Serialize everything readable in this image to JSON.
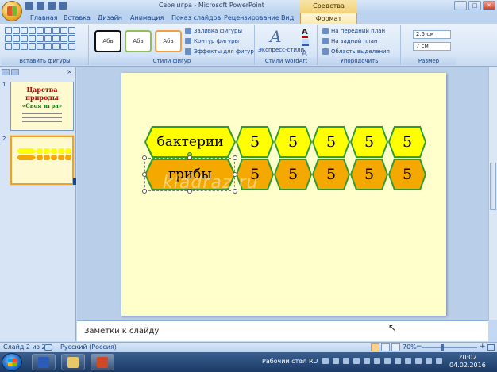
{
  "window": {
    "title": "Своя игра - Microsoft PowerPoint",
    "context_tab_title": "Средства рисования",
    "controls": [
      "–",
      "□",
      "✕"
    ]
  },
  "tabs": [
    {
      "label": "Главная"
    },
    {
      "label": "Вставка"
    },
    {
      "label": "Дизайн"
    },
    {
      "label": "Анимация"
    },
    {
      "label": "Показ слайдов"
    },
    {
      "label": "Рецензирование"
    },
    {
      "label": "Вид"
    },
    {
      "label": "Формат",
      "active": true
    }
  ],
  "ribbon": {
    "groups": [
      {
        "label": "Вставить фигуры"
      },
      {
        "label": "Стили фигур"
      },
      {
        "label": "Стили WordArt"
      },
      {
        "label": "Упорядочить"
      },
      {
        "label": "Размер"
      }
    ],
    "shape_styles": [
      "Абв",
      "Абв",
      "Абв"
    ],
    "shape_style_commands": [
      "Заливка фигуры",
      "Контур фигуры",
      "Эффекты для фигур"
    ],
    "wordart_label": "Экспресс-стили",
    "arrange_commands": [
      "На передний план",
      "На задний план",
      "Область выделения"
    ],
    "size": {
      "height": "2,5 см",
      "width": "7 см"
    }
  },
  "slides_pane": {
    "slides": [
      {
        "number": "1",
        "title": "Царства природы",
        "subtitle": "«Своя игра»"
      },
      {
        "number": "2",
        "selected": true
      }
    ]
  },
  "slide": {
    "rows": [
      {
        "category": "бактерии",
        "values": [
          "5",
          "5",
          "5",
          "5",
          "5"
        ],
        "color": "#ffff00"
      },
      {
        "category": "грибы",
        "values": [
          "5",
          "5",
          "5",
          "5",
          "5"
        ],
        "color": "#f5a800"
      }
    ],
    "watermark": "kladraz.ru"
  },
  "notes": {
    "placeholder": "Заметки к слайду"
  },
  "status": {
    "slide_info": "Слайд 2 из 2",
    "language": "Русский (Россия)",
    "zoom": "70%"
  },
  "taskbar": {
    "desktop_label": "Рабочий стол",
    "language": "RU",
    "time": "20:02",
    "date": "04.02.2016"
  }
}
